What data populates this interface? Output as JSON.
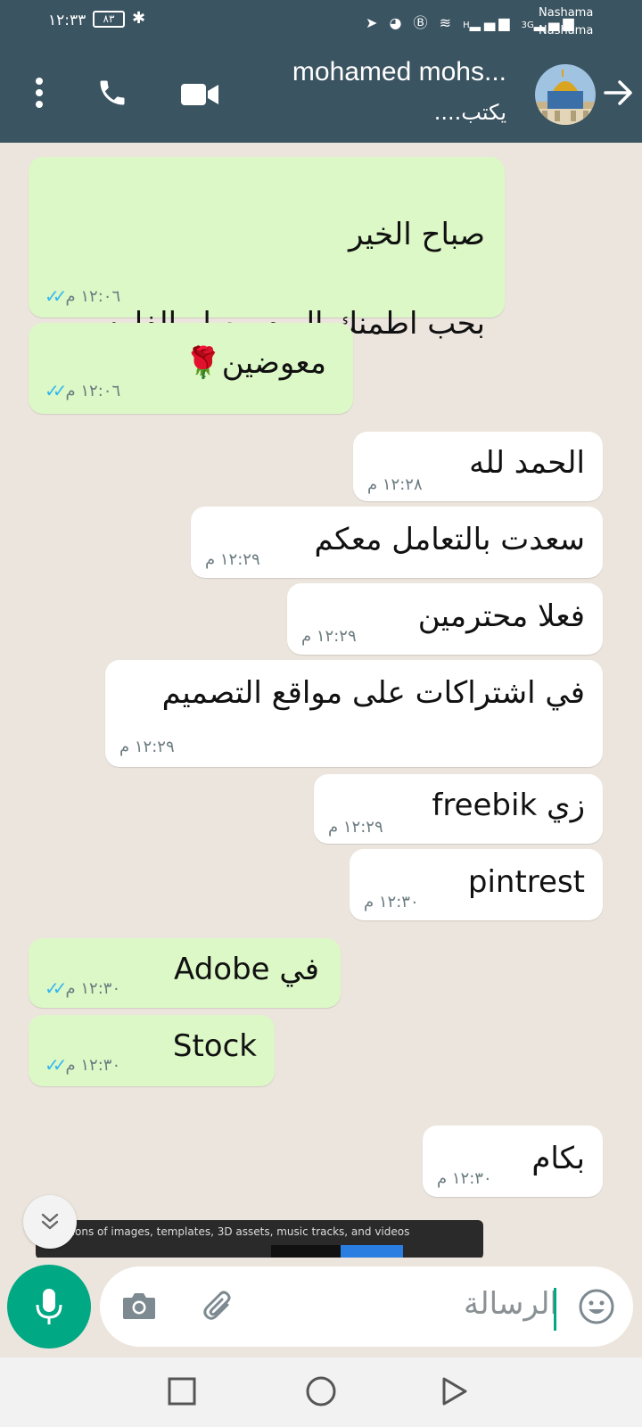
{
  "status_bar": {
    "time": "١٢:٣٣",
    "battery": "٨٣",
    "carrier1": "Nashama",
    "carrier2": "Nashama",
    "signal_labels": [
      "H",
      "3G"
    ]
  },
  "header": {
    "contact_name": "mohamed mohs...",
    "contact_status": "يكتب...."
  },
  "messages": [
    {
      "dir": "out",
      "lines": [
        "صباح الخير",
        "بحب اطمنك اليوم وصلو الفلوس"
      ],
      "time": "١٢:٠٦ م",
      "read": true
    },
    {
      "dir": "out",
      "lines": [
        "معوضين🌹"
      ],
      "time": "١٢:٠٦ م",
      "read": true
    },
    {
      "dir": "in",
      "lines": [
        "الحمد لله"
      ],
      "time": "١٢:٢٨ م"
    },
    {
      "dir": "in",
      "lines": [
        "سعدت بالتعامل معكم"
      ],
      "time": "١٢:٢٩ م"
    },
    {
      "dir": "in",
      "lines": [
        "فعلا محترمين"
      ],
      "time": "١٢:٢٩ م"
    },
    {
      "dir": "in",
      "lines": [
        "في  اشتراكات على مواقع التصميم"
      ],
      "time": "١٢:٢٩ م"
    },
    {
      "dir": "in",
      "lines": [
        "زي freebik"
      ],
      "time": "١٢:٢٩ م"
    },
    {
      "dir": "in",
      "lines": [
        "pintrest"
      ],
      "time": "١٢:٣٠ م"
    },
    {
      "dir": "out",
      "lines": [
        "في Adobe"
      ],
      "time": "١٢:٣٠ م",
      "read": true
    },
    {
      "dir": "out",
      "lines": [
        "Stock"
      ],
      "time": "١٢:٣٠ م",
      "read": true
    },
    {
      "dir": "in",
      "lines": [
        "بكام"
      ],
      "time": "١٢:٣٠ م"
    }
  ],
  "preview": {
    "text": "llions of images, templates, 3D assets, music tracks, and videos"
  },
  "composer": {
    "placeholder": "الرسالة"
  },
  "icons": {
    "more": "more-vertical-icon",
    "call": "phone-icon",
    "video": "video-camera-icon",
    "back": "arrow-icon",
    "mic": "microphone-icon",
    "camera": "camera-icon",
    "attach": "paperclip-icon",
    "emoji": "emoji-icon",
    "scroll": "double-chevron-down-icon",
    "nav_recents": "square-icon",
    "nav_home": "circle-icon",
    "nav_back": "triangle-back-icon"
  },
  "colors": {
    "header": "#3b5461",
    "outgoing": "#dcf8c6",
    "incoming": "#ffffff",
    "accent": "#00a884",
    "read_ticks": "#34b7f1"
  }
}
